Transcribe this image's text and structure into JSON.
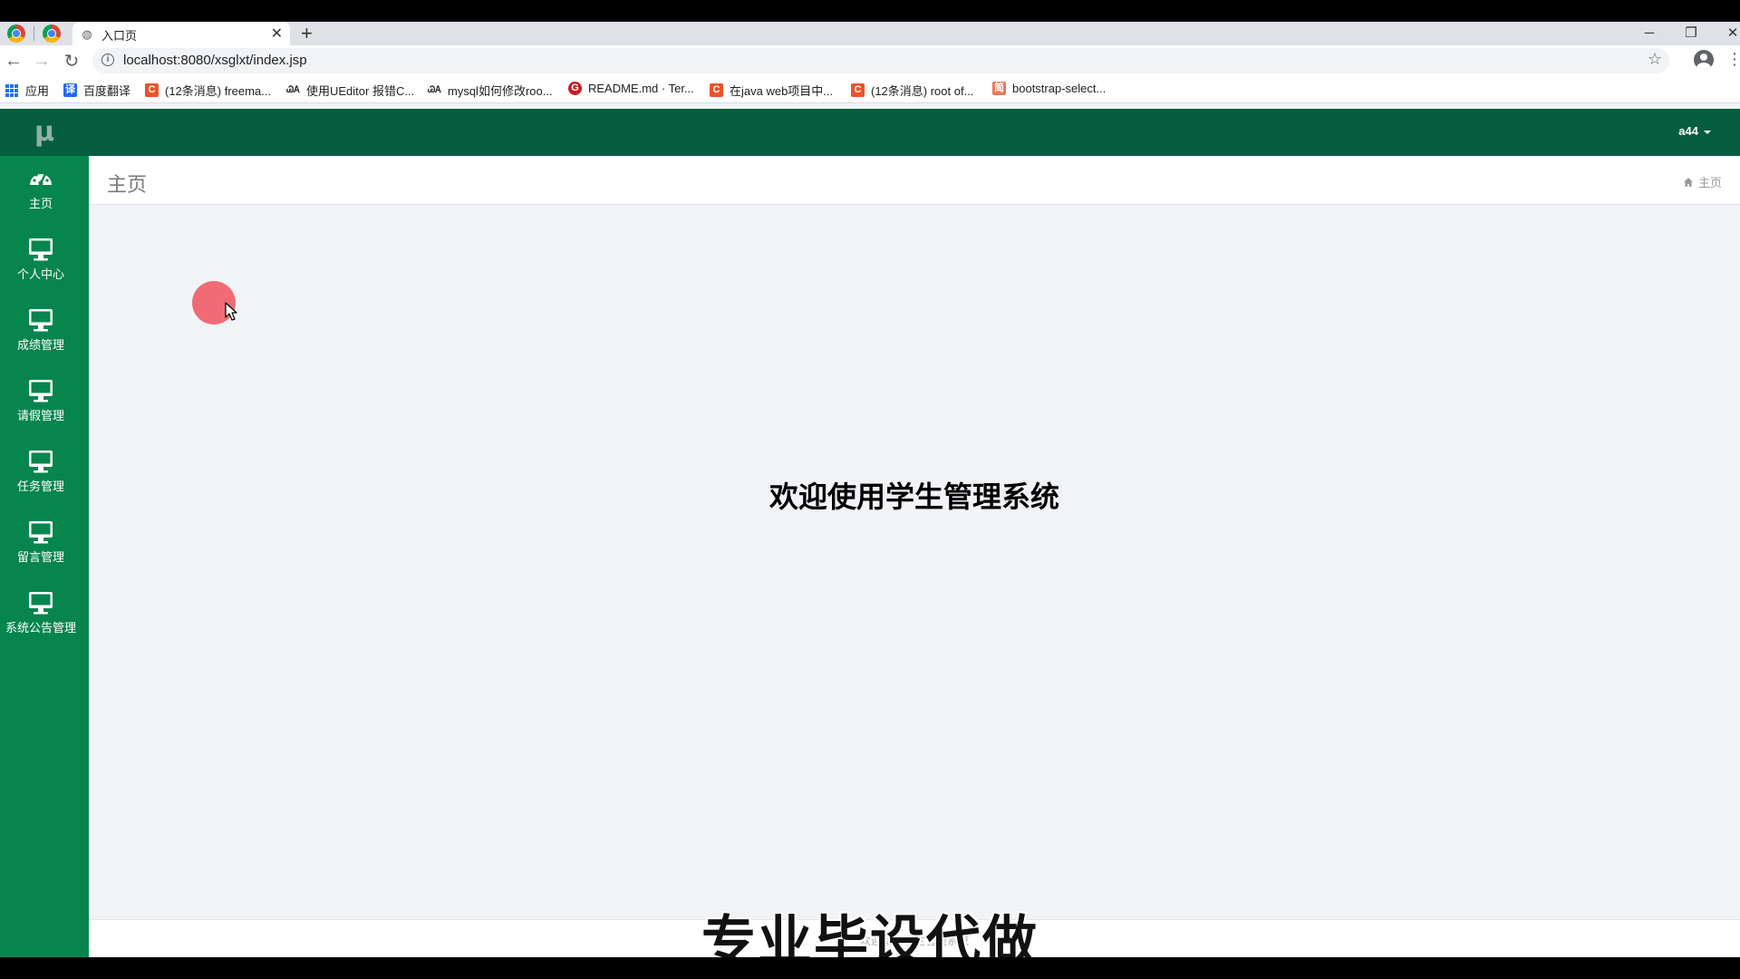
{
  "browser": {
    "tab_title": "入口页",
    "new_tab_icon": "plus-icon",
    "url": "localhost:8080/xsglxt/index.jsp",
    "window_controls": [
      "minimize-icon",
      "restore-icon",
      "close-icon"
    ],
    "bookmarks": [
      {
        "label": "应用",
        "icon": "apps-grid-icon",
        "color": "#1a73e8"
      },
      {
        "label": "百度翻译",
        "icon": "baidu-translate-icon",
        "icon_text": "译",
        "color": "#2468f2"
      },
      {
        "label": "(12条消息) freema...",
        "icon": "csdn-icon",
        "icon_text": "C",
        "color": "#e8542b"
      },
      {
        "label": "使用UEditor 报错C...",
        "icon": "logo-icon",
        "icon_text": "ᏊᎪ",
        "color": "#333333"
      },
      {
        "label": "mysql如何修改roo...",
        "icon": "logo-icon",
        "icon_text": "ᏊᎪ",
        "color": "#333333"
      },
      {
        "label": "README.md · Ter...",
        "icon": "gitee-icon",
        "icon_text": "G",
        "color": "#c71d23"
      },
      {
        "label": "在java web项目中...",
        "icon": "csdn-icon",
        "icon_text": "C",
        "color": "#e8542b"
      },
      {
        "label": "(12条消息) root of...",
        "icon": "csdn-icon",
        "icon_text": "C",
        "color": "#e8542b"
      },
      {
        "label": "bootstrap-select...",
        "icon": "jianshu-icon",
        "icon_text": "简",
        "color": "#e9775c"
      }
    ]
  },
  "app": {
    "brand": "μ",
    "user": "a44",
    "sidebar": [
      {
        "label": "主页",
        "icon": "dashboard-icon"
      },
      {
        "label": "个人中心",
        "icon": "monitor-icon"
      },
      {
        "label": "成绩管理",
        "icon": "monitor-icon"
      },
      {
        "label": "请假管理",
        "icon": "monitor-icon"
      },
      {
        "label": "任务管理",
        "icon": "monitor-icon"
      },
      {
        "label": "留言管理",
        "icon": "monitor-icon"
      },
      {
        "label": "系统公告管理",
        "icon": "monitor-icon"
      }
    ],
    "page_title": "主页",
    "breadcrumb": {
      "icon": "home-icon",
      "label": "主页"
    },
    "welcome": "欢迎使用学生管理系统",
    "footer": "欢迎使用学生管理系统",
    "colors": {
      "sidebar": "#07854f",
      "topbar": "#055e3f"
    }
  },
  "overlay": {
    "watermark": "专业毕设代做",
    "click_marker_color": "#f0606a"
  }
}
